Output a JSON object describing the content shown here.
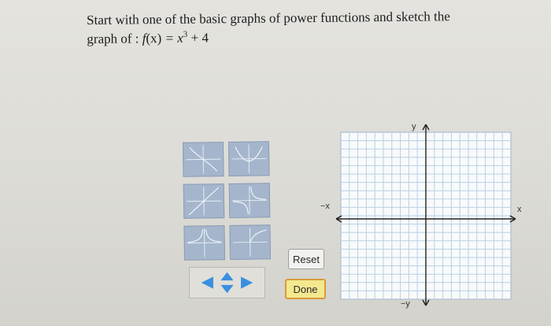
{
  "question": {
    "line1": "Start with one of the basic graphs of power functions and sketch the",
    "line2_prefix": "graph of : ",
    "fname": "f",
    "paren_x": "(x)",
    "equals": " = x",
    "exponent": "3",
    "constant": " + 4"
  },
  "palette": {
    "tiles": [
      {
        "icon": "power-graph-tile-1-icon"
      },
      {
        "icon": "power-graph-tile-2-icon"
      },
      {
        "icon": "power-graph-tile-3-icon"
      },
      {
        "icon": "power-graph-tile-4-icon"
      },
      {
        "icon": "power-graph-tile-5-icon"
      },
      {
        "icon": "power-graph-tile-6-icon"
      }
    ],
    "move_control_icon": "move-arrows-icon"
  },
  "buttons": {
    "reset": "Reset",
    "done": "Done"
  },
  "graph": {
    "y_label": "y",
    "neg_x_label": "−x",
    "x_label": "x",
    "neg_y_label": "−y",
    "grid_color": "#b9d0e4",
    "axis_color": "#222222"
  },
  "colors": {
    "tile_fill": "#a5b6cc",
    "arrow_blue": "#3b8fe0",
    "done_fill": "#f4e88e",
    "done_border": "#d99a3a"
  }
}
